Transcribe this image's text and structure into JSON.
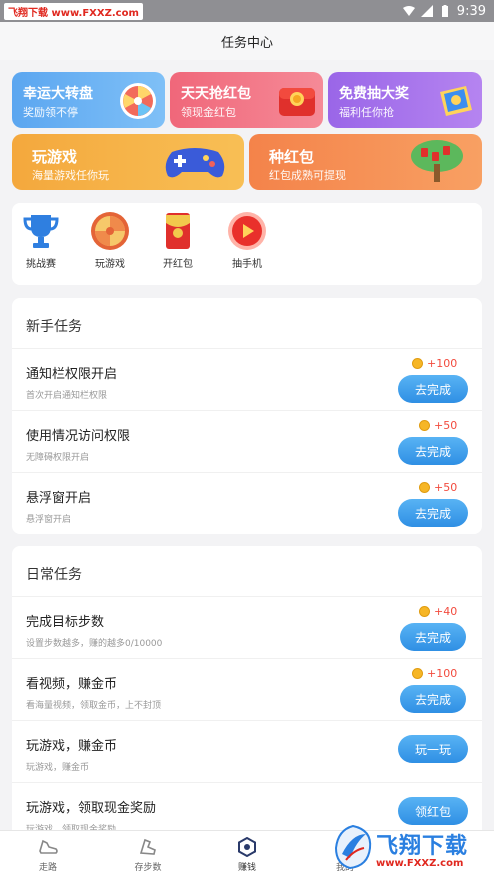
{
  "status_bar": {
    "watermark": "飞翔下载 www.FXXZ.com",
    "time": "9:39"
  },
  "header": {
    "title": "任务中心"
  },
  "banners": [
    {
      "title": "幸运大转盘",
      "subtitle": "奖励领不停"
    },
    {
      "title": "天天抢红包",
      "subtitle": "领现金红包"
    },
    {
      "title": "免费抽大奖",
      "subtitle": "福利任你抢"
    },
    {
      "title": "玩游戏",
      "subtitle": "海量游戏任你玩"
    },
    {
      "title": "种红包",
      "subtitle": "红包成熟可提现"
    }
  ],
  "quick_icons": [
    {
      "label": "挑战赛",
      "icon": "trophy-icon"
    },
    {
      "label": "玩游戏",
      "icon": "wheel-icon"
    },
    {
      "label": "开红包",
      "icon": "red-packet-icon"
    },
    {
      "label": "抽手机",
      "icon": "play-circle-icon"
    }
  ],
  "newbie": {
    "title": "新手任务",
    "tasks": [
      {
        "title": "通知栏权限开启",
        "desc": "首次开启通知栏权限",
        "reward": "+100",
        "button": "去完成"
      },
      {
        "title": "使用情况访问权限",
        "desc": "无障碍权限开启",
        "reward": "+50",
        "button": "去完成"
      },
      {
        "title": "悬浮窗开启",
        "desc": "悬浮窗开启",
        "reward": "+50",
        "button": "去完成"
      }
    ]
  },
  "daily": {
    "title": "日常任务",
    "tasks": [
      {
        "title": "完成目标步数",
        "desc": "设置步数越多，赚的越多0/10000",
        "reward": "+40",
        "button": "去完成"
      },
      {
        "title": "看视频，赚金币",
        "desc": "看海量视频，领取金币，上不封顶",
        "reward": "+100",
        "button": "去完成"
      },
      {
        "title": "玩游戏，赚金币",
        "desc": "玩游戏，赚金币",
        "reward": "",
        "button": "玩一玩"
      },
      {
        "title": "玩游戏，领取现金奖励",
        "desc": "玩游戏，领取现金奖励",
        "reward": "",
        "button": "领红包"
      }
    ]
  },
  "bottom_nav": [
    {
      "label": "走路",
      "icon": "shoe-icon"
    },
    {
      "label": "存步数",
      "icon": "footprint-icon"
    },
    {
      "label": "赚钱",
      "icon": "coin-hex-icon"
    },
    {
      "label": "我的",
      "icon": "user-icon"
    }
  ],
  "watermark_logo": {
    "text": "飞翔下载",
    "url": "www.FXXZ.com"
  },
  "colors": {
    "accent_blue": "#2f8fe4",
    "reward_red": "#f24b3e",
    "coin": "#f6b626"
  }
}
